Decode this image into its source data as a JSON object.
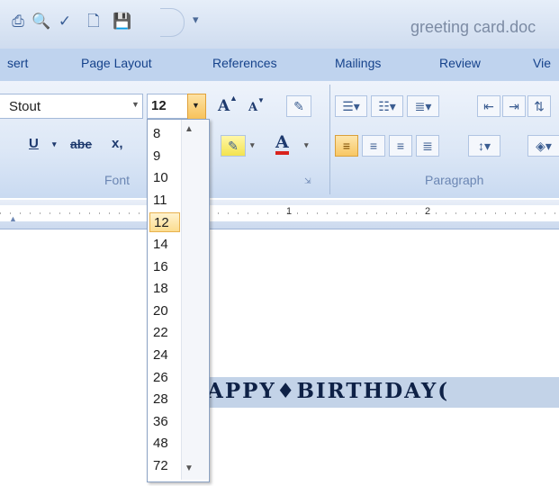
{
  "window": {
    "title": "greeting card.doc",
    "quick_access": [
      {
        "icon": "print-icon",
        "glyph": "⎙"
      },
      {
        "icon": "print-preview-icon",
        "glyph": "🔍"
      },
      {
        "icon": "spelling-icon",
        "glyph": "✓"
      },
      {
        "icon": "new-document-icon",
        "glyph": "🗋"
      },
      {
        "icon": "save-icon",
        "glyph": "💾"
      }
    ],
    "customize_glyph": "▾"
  },
  "tabs": [
    "sert",
    "Page Layout",
    "References",
    "Mailings",
    "Review",
    "Vie"
  ],
  "font_group": {
    "label": "Font",
    "font_name": "Stout",
    "font_size": "12",
    "grow_font": "A",
    "shrink_font": "A",
    "underline": "U",
    "strikethrough": "abe",
    "subscript": "x,",
    "highlight_glyph": "✎",
    "font_color": "A"
  },
  "paragraph_group": {
    "label": "Paragraph"
  },
  "ruler": {
    "marks": [
      "1",
      "2"
    ]
  },
  "font_size_list": {
    "options": [
      "8",
      "9",
      "10",
      "11",
      "12",
      "14",
      "16",
      "18",
      "20",
      "22",
      "24",
      "26",
      "28",
      "36",
      "48",
      "72"
    ],
    "selected": "12",
    "scroll_up": "▲",
    "scroll_down": "▼"
  },
  "document": {
    "visible_text": "APPY♦BIRTHDAY("
  },
  "colors": {
    "ribbon_blue": "#bfd3ee",
    "title_text": "#15428b",
    "selected_highlight": "#fbdc8f",
    "card_text": "#0e2146"
  }
}
